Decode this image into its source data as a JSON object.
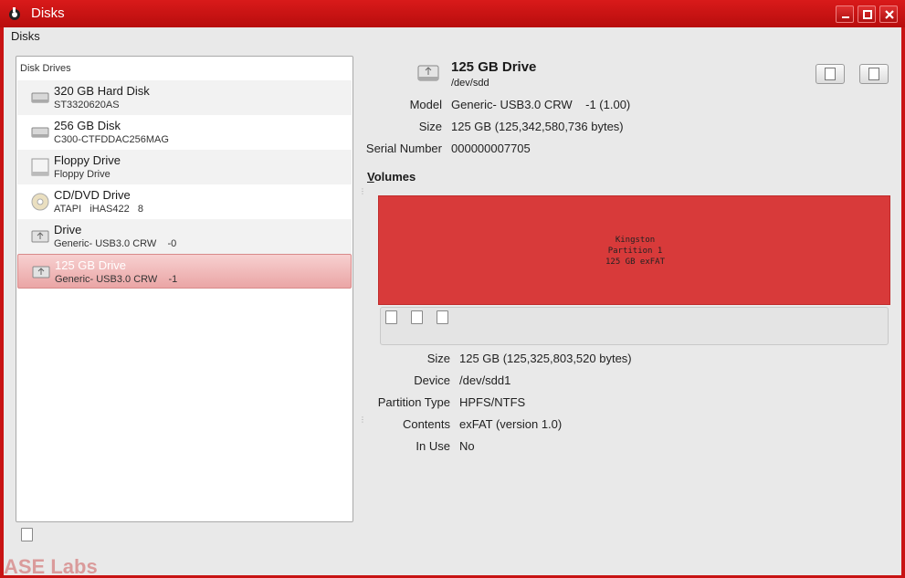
{
  "window": {
    "title": "Disks"
  },
  "menubar": {
    "items": [
      "Disks"
    ]
  },
  "drives_panel": {
    "header": "Disk Drives",
    "drives": [
      {
        "name": "320 GB Hard Disk",
        "sub": "ST3320620AS",
        "icon": "hard-disk-icon"
      },
      {
        "name": "256 GB Disk",
        "sub": "C300-CTFDDAC256MAG",
        "icon": "hard-disk-icon"
      },
      {
        "name": "Floppy Drive",
        "sub": "Floppy Drive",
        "icon": "floppy-icon"
      },
      {
        "name": "CD/DVD Drive",
        "sub": "ATAPI   iHAS422   8",
        "icon": "optical-disc-icon"
      },
      {
        "name": "Drive",
        "sub": "Generic- USB3.0 CRW    -0",
        "icon": "usb-drive-icon"
      },
      {
        "name": "125 GB Drive",
        "sub": "Generic- USB3.0 CRW    -1",
        "icon": "usb-drive-icon",
        "selected": true
      }
    ]
  },
  "disk": {
    "title": "125 GB Drive",
    "device": "/dev/sdd",
    "fields": [
      {
        "label": "Model",
        "value": "Generic- USB3.0 CRW    -1 (1.00)"
      },
      {
        "label": "Size",
        "value": "125 GB (125,342,580,736 bytes)"
      },
      {
        "label": "Serial Number",
        "value": "000000007705"
      }
    ]
  },
  "volumes": {
    "title_prefix": "V",
    "title_rest": "olumes",
    "partition": {
      "line1": "Kingston",
      "line2": "Partition 1",
      "line3": "125 GB exFAT"
    },
    "fields": [
      {
        "label": "Size",
        "value": "125 GB (125,325,803,520 bytes)"
      },
      {
        "label": "Device",
        "value": "/dev/sdd1"
      },
      {
        "label": "Partition Type",
        "value": "HPFS/NTFS"
      },
      {
        "label": "Contents",
        "value": "exFAT (version 1.0)"
      },
      {
        "label": "In Use",
        "value": "No"
      }
    ]
  },
  "watermark": "ASE Labs",
  "colors": {
    "accent": "#c81313",
    "partition": "#d83a3a",
    "selection": "#eaa5a5"
  }
}
